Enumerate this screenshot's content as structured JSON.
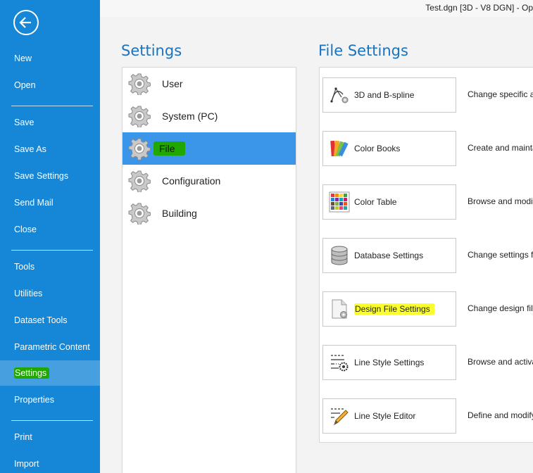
{
  "window": {
    "title": "Test.dgn [3D - V8 DGN] - Op"
  },
  "nav": {
    "back_icon": "back-arrow-icon",
    "items": [
      {
        "label": "New"
      },
      {
        "label": "Open"
      },
      {
        "label": "Save"
      },
      {
        "label": "Save As"
      },
      {
        "label": "Save Settings"
      },
      {
        "label": "Send Mail"
      },
      {
        "label": "Close"
      },
      {
        "label": "Tools"
      },
      {
        "label": "Utilities"
      },
      {
        "label": "Dataset Tools"
      },
      {
        "label": "Parametric Content"
      },
      {
        "label": "Settings"
      },
      {
        "label": "Properties"
      },
      {
        "label": "Print"
      },
      {
        "label": "Import"
      }
    ]
  },
  "settings": {
    "title": "Settings",
    "items": [
      {
        "label": "User"
      },
      {
        "label": "System (PC)"
      },
      {
        "label": "File"
      },
      {
        "label": "Configuration"
      },
      {
        "label": "Building"
      }
    ]
  },
  "file_settings": {
    "title": "File Settings",
    "items": [
      {
        "label": "3D and B-spline",
        "description": "Change specific at",
        "icon": "bspline-icon"
      },
      {
        "label": "Color Books",
        "description": "Create and mainta",
        "icon": "color-books-icon"
      },
      {
        "label": "Color Table",
        "description": "Browse and modif",
        "icon": "color-table-icon"
      },
      {
        "label": "Database Settings",
        "description": "Change settings fo",
        "icon": "database-icon"
      },
      {
        "label": "Design File Settings",
        "description": "Change design file",
        "icon": "design-file-icon"
      },
      {
        "label": "Line Style Settings",
        "description": "Browse and activa",
        "icon": "line-style-settings-icon"
      },
      {
        "label": "Line Style Editor",
        "description": "Define and modify",
        "icon": "line-style-editor-icon"
      }
    ]
  },
  "colors": {
    "nav_bg": "#1686d6",
    "selected_bg": "#3b95e8",
    "title_blue": "#1a73c0",
    "highlight_green": "#21a800",
    "highlight_yellow": "#fbff2a"
  }
}
